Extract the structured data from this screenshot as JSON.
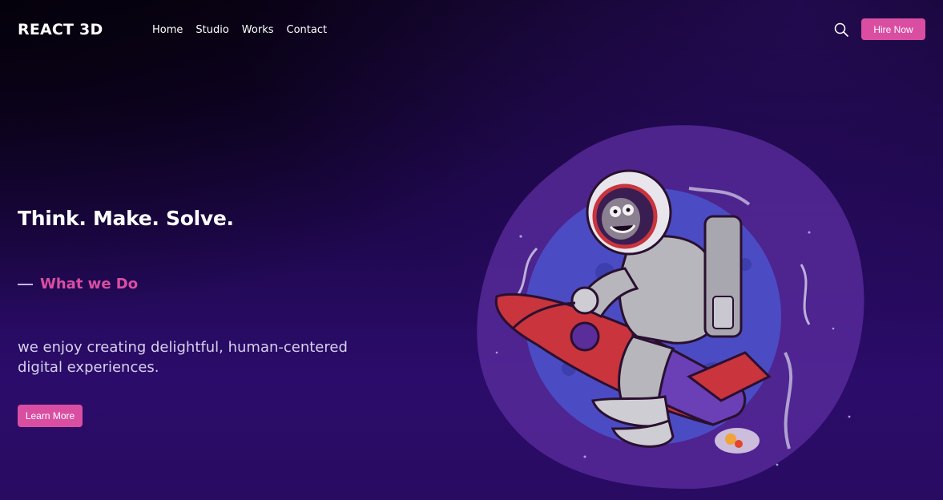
{
  "nav": {
    "logo": "REACT 3D",
    "links": [
      "Home",
      "Studio",
      "Works",
      "Contact"
    ],
    "search_icon": "search-icon",
    "hire_label": "Hire Now"
  },
  "hero": {
    "title": "Think. Make. Solve.",
    "subtitle": "What we Do",
    "description": "we enjoy creating delightful, human-centered digital experiences.",
    "button_label": "Learn More",
    "illustration": "astronaut-on-rocket-illustration"
  },
  "colors": {
    "accent": "#da4ea2",
    "background_dark": "#0b0219",
    "background_purple": "#2b0c6a",
    "blob": "#5c2ea0",
    "planet": "#4b4cc4"
  }
}
